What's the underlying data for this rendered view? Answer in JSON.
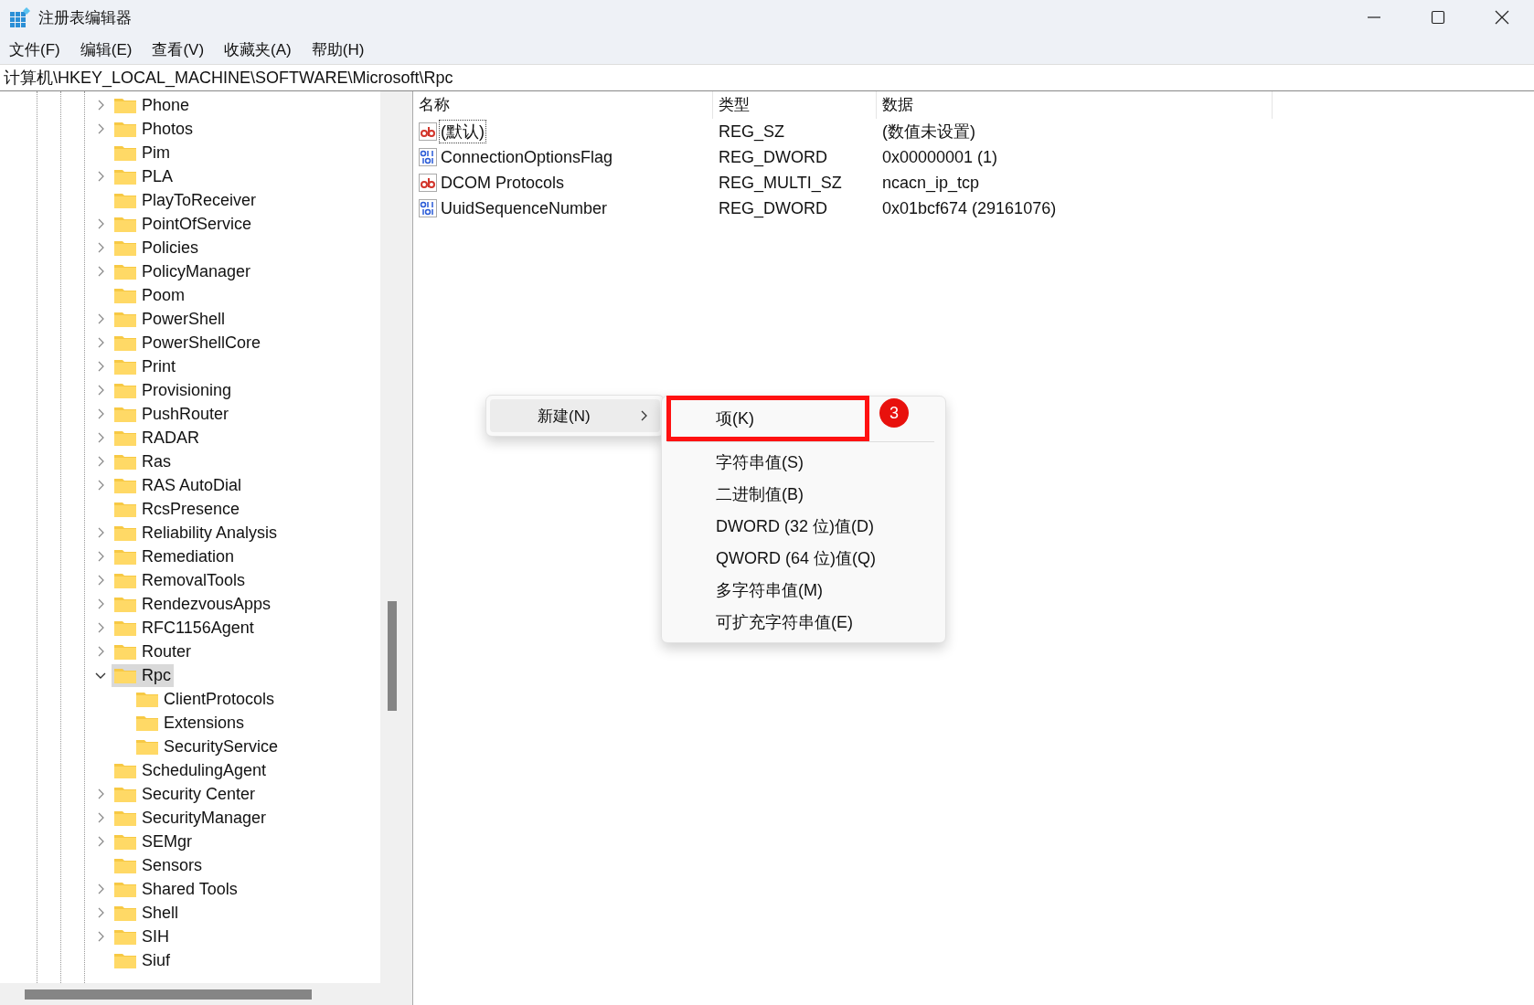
{
  "window": {
    "title": "注册表编辑器"
  },
  "menu_bar": [
    "文件(F)",
    "编辑(E)",
    "查看(V)",
    "收藏夹(A)",
    "帮助(H)"
  ],
  "address": "计算机\\HKEY_LOCAL_MACHINE\\SOFTWARE\\Microsoft\\Rpc",
  "tree": [
    {
      "label": "Phone",
      "has_children": true,
      "expanded": false,
      "selected": false
    },
    {
      "label": "Photos",
      "has_children": true,
      "expanded": false,
      "selected": false
    },
    {
      "label": "Pim",
      "has_children": false,
      "selected": false
    },
    {
      "label": "PLA",
      "has_children": true,
      "expanded": false,
      "selected": false
    },
    {
      "label": "PlayToReceiver",
      "has_children": false,
      "selected": false
    },
    {
      "label": "PointOfService",
      "has_children": true,
      "expanded": false,
      "selected": false
    },
    {
      "label": "Policies",
      "has_children": true,
      "expanded": false,
      "selected": false
    },
    {
      "label": "PolicyManager",
      "has_children": true,
      "expanded": false,
      "selected": false
    },
    {
      "label": "Poom",
      "has_children": false,
      "selected": false
    },
    {
      "label": "PowerShell",
      "has_children": true,
      "expanded": false,
      "selected": false
    },
    {
      "label": "PowerShellCore",
      "has_children": true,
      "expanded": false,
      "selected": false
    },
    {
      "label": "Print",
      "has_children": true,
      "expanded": false,
      "selected": false
    },
    {
      "label": "Provisioning",
      "has_children": true,
      "expanded": false,
      "selected": false
    },
    {
      "label": "PushRouter",
      "has_children": true,
      "expanded": false,
      "selected": false
    },
    {
      "label": "RADAR",
      "has_children": true,
      "expanded": false,
      "selected": false
    },
    {
      "label": "Ras",
      "has_children": true,
      "expanded": false,
      "selected": false
    },
    {
      "label": "RAS AutoDial",
      "has_children": true,
      "expanded": false,
      "selected": false
    },
    {
      "label": "RcsPresence",
      "has_children": false,
      "selected": false
    },
    {
      "label": "Reliability Analysis",
      "has_children": true,
      "expanded": false,
      "selected": false
    },
    {
      "label": "Remediation",
      "has_children": true,
      "expanded": false,
      "selected": false
    },
    {
      "label": "RemovalTools",
      "has_children": true,
      "expanded": false,
      "selected": false
    },
    {
      "label": "RendezvousApps",
      "has_children": true,
      "expanded": false,
      "selected": false
    },
    {
      "label": "RFC1156Agent",
      "has_children": true,
      "expanded": false,
      "selected": false
    },
    {
      "label": "Router",
      "has_children": true,
      "expanded": false,
      "selected": false
    },
    {
      "label": "Rpc",
      "has_children": true,
      "expanded": true,
      "selected": true,
      "children": [
        {
          "label": "ClientProtocols",
          "has_children": false,
          "selected": false
        },
        {
          "label": "Extensions",
          "has_children": false,
          "selected": false
        },
        {
          "label": "SecurityService",
          "has_children": false,
          "selected": false
        }
      ]
    },
    {
      "label": "SchedulingAgent",
      "has_children": false,
      "selected": false
    },
    {
      "label": "Security Center",
      "has_children": true,
      "expanded": false,
      "selected": false
    },
    {
      "label": "SecurityManager",
      "has_children": true,
      "expanded": false,
      "selected": false
    },
    {
      "label": "SEMgr",
      "has_children": true,
      "expanded": false,
      "selected": false
    },
    {
      "label": "Sensors",
      "has_children": false,
      "selected": false
    },
    {
      "label": "Shared Tools",
      "has_children": true,
      "expanded": false,
      "selected": false
    },
    {
      "label": "Shell",
      "has_children": true,
      "expanded": false,
      "selected": false
    },
    {
      "label": "SIH",
      "has_children": true,
      "expanded": false,
      "selected": false
    },
    {
      "label": "Siuf",
      "has_children": false,
      "selected": false
    }
  ],
  "values_table": {
    "columns": [
      "名称",
      "类型",
      "数据"
    ],
    "rows": [
      {
        "kind": "string",
        "name": "(默认)",
        "type": "REG_SZ",
        "data": "(数值未设置)",
        "focused": true
      },
      {
        "kind": "binary",
        "name": "ConnectionOptionsFlag",
        "type": "REG_DWORD",
        "data": "0x00000001 (1)",
        "focused": false
      },
      {
        "kind": "string",
        "name": "DCOM Protocols",
        "type": "REG_MULTI_SZ",
        "data": "ncacn_ip_tcp",
        "focused": false
      },
      {
        "kind": "binary",
        "name": "UuidSequenceNumber",
        "type": "REG_DWORD",
        "data": "0x01bcf674 (29161076)",
        "focused": false
      }
    ]
  },
  "context_menu": {
    "items": [
      {
        "label": "新建(N)",
        "has_submenu": true,
        "selected": true
      }
    ]
  },
  "submenu": {
    "items": [
      {
        "kind": "item",
        "label": "项(K)",
        "highlighted": true,
        "step": "3"
      },
      {
        "kind": "separator"
      },
      {
        "kind": "item",
        "label": "字符串值(S)",
        "highlighted": false
      },
      {
        "kind": "item",
        "label": "二进制值(B)",
        "highlighted": false
      },
      {
        "kind": "item",
        "label": "DWORD (32 位)值(D)",
        "highlighted": false
      },
      {
        "kind": "item",
        "label": "QWORD (64 位)值(Q)",
        "highlighted": false
      },
      {
        "kind": "item",
        "label": "多字符串值(M)",
        "highlighted": false
      },
      {
        "kind": "item",
        "label": "可扩充字符串值(E)",
        "highlighted": false
      }
    ]
  }
}
